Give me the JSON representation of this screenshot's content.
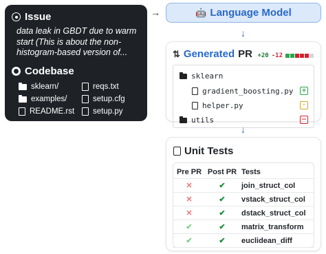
{
  "issue": {
    "title": "Issue",
    "text": "data leak in GBDT due to warm start (This is about the non-histogram-based version of..."
  },
  "codebase": {
    "title": "Codebase",
    "items": [
      {
        "name": "sklearn/",
        "type": "folder"
      },
      {
        "name": "reqs.txt",
        "type": "file"
      },
      {
        "name": "examples/",
        "type": "folder"
      },
      {
        "name": "setup.cfg",
        "type": "file"
      },
      {
        "name": "README.rst",
        "type": "file"
      },
      {
        "name": "setup.py",
        "type": "file"
      }
    ]
  },
  "model": {
    "label": "Language Model",
    "icon": "robot-icon"
  },
  "pr": {
    "title_accent": "Generated",
    "title_rest": "PR",
    "additions": "+20",
    "deletions": "-12",
    "diff_blocks": [
      "#2da44e",
      "#2da44e",
      "#cf222e",
      "#cf222e",
      "#cf222e",
      "#d0d7de"
    ],
    "tree": [
      {
        "name": "sklearn",
        "type": "folder",
        "badge": ""
      },
      {
        "name": "gradient_boosting.py",
        "type": "file",
        "badge": "added",
        "badge_color": "#2da44e"
      },
      {
        "name": "helper.py",
        "type": "file",
        "badge": "modified",
        "badge_color": "#d4a72c"
      },
      {
        "name": "utils",
        "type": "folder",
        "badge": "removed",
        "badge_color": "#cf222e"
      }
    ]
  },
  "unit_tests": {
    "title": "Unit Tests",
    "columns": [
      "Pre PR",
      "Post PR",
      "Tests"
    ],
    "rows": [
      {
        "pre": "fail",
        "post": "pass",
        "test": "join_struct_col"
      },
      {
        "pre": "fail",
        "post": "pass",
        "test": "vstack_struct_col"
      },
      {
        "pre": "fail",
        "post": "pass",
        "test": "dstack_struct_col"
      },
      {
        "pre": "pass",
        "post": "pass",
        "test": "matrix_transform"
      },
      {
        "pre": "pass",
        "post": "pass",
        "test": "euclidean_diff"
      }
    ]
  }
}
